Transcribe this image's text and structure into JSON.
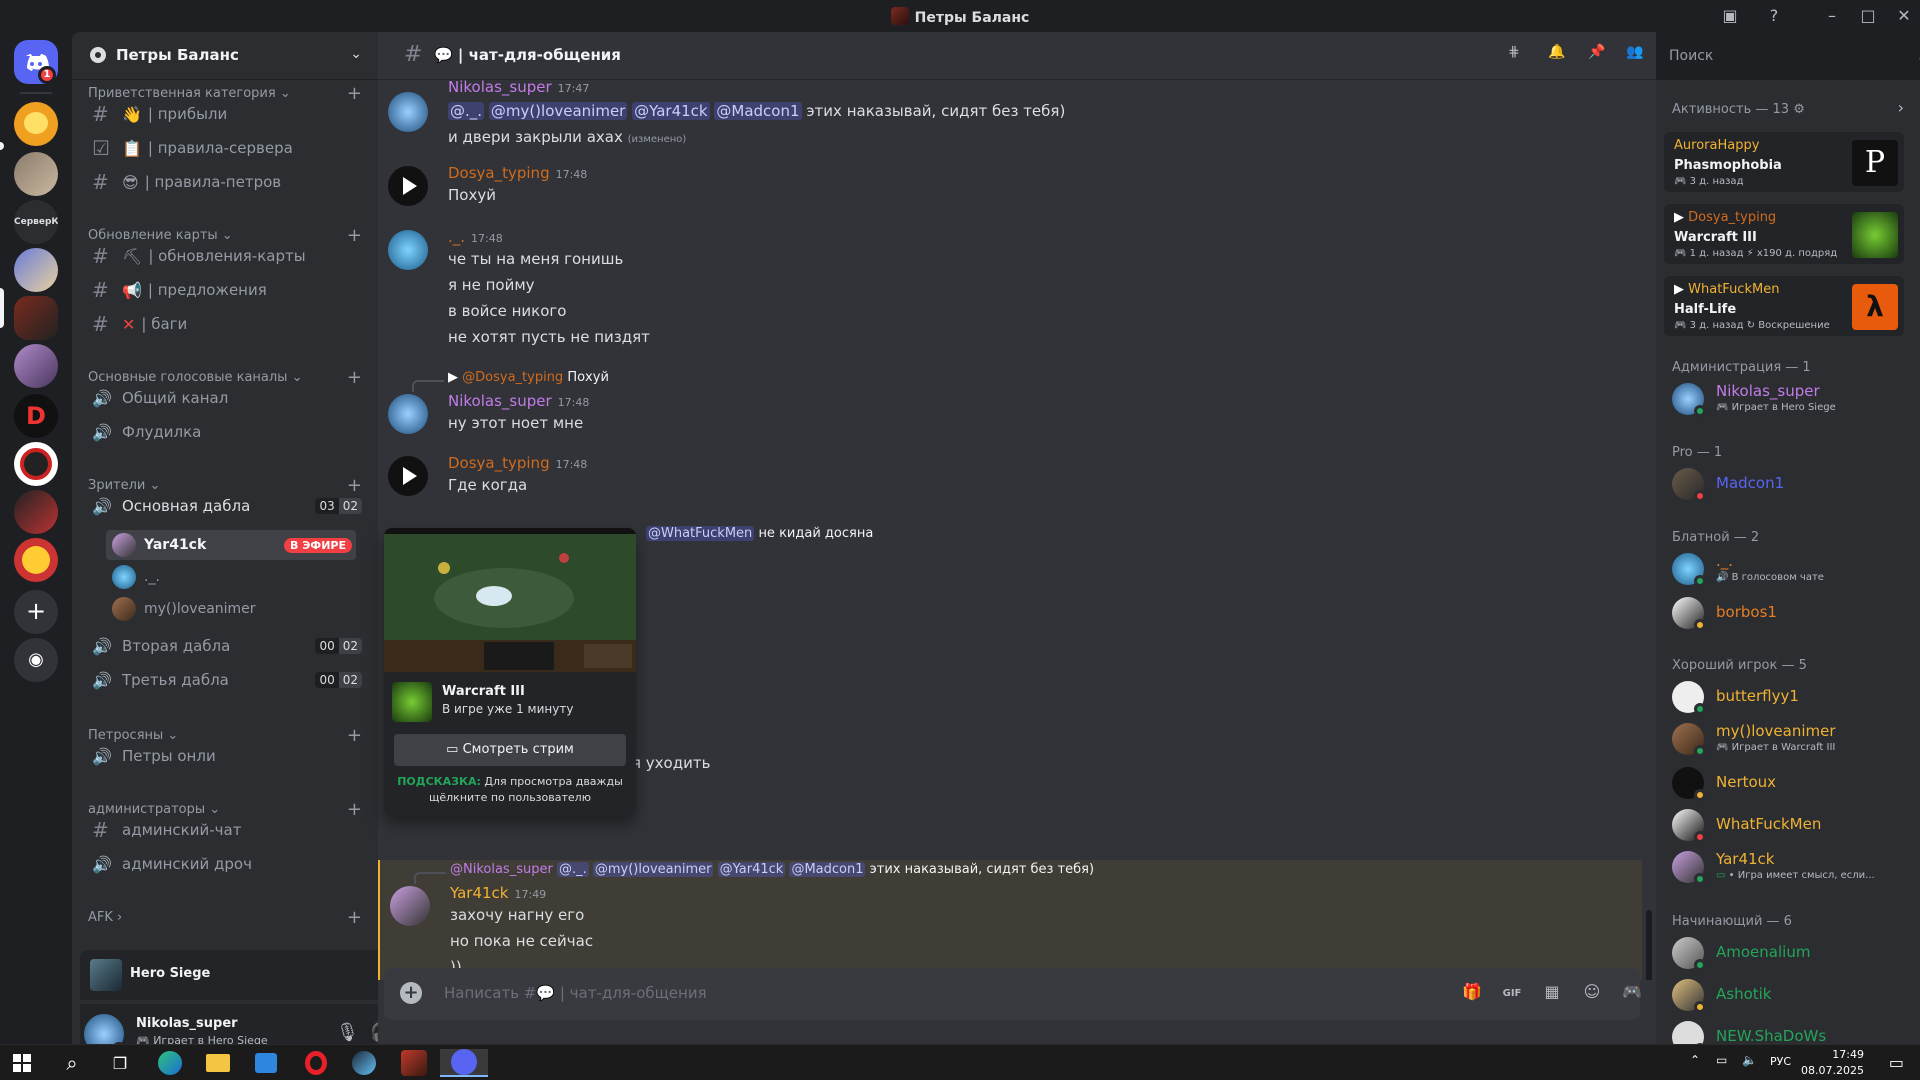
{
  "window": {
    "title": "Петры Баланс"
  },
  "server": {
    "name": "Петры Баланс",
    "dm_badge": "1",
    "folder_label": "СерверК"
  },
  "sidebar": {
    "categories": [
      "Приветственная категория ⌄",
      "Обновление карты ⌄",
      "Основные голосовые каналы ⌄",
      "Зрители ⌄",
      "Петросяны ⌄",
      "администраторы ⌄",
      "AFK ›"
    ],
    "channels": {
      "pribyli": "| прибыли",
      "pravila_servera": "| правила-сервера",
      "pravila_petrov": "| правила-петров",
      "obnovleniya": "| обновления-карты",
      "predlozheniya": "| предложения",
      "bagi": "| баги",
      "obshiy": "Общий канал",
      "fludilka": "Флудилка",
      "osnovnaya": "Основная дабла",
      "osnovnaya_cnt": [
        "03",
        "02"
      ],
      "vtoraya": "Вторая дабла",
      "vtoraya_cnt": [
        "00",
        "02"
      ],
      "tretya": "Третья дабла",
      "tretya_cnt": [
        "00",
        "02"
      ],
      "petry_onli": "Петры онли",
      "admin_chat": "админский-чат",
      "admin_droch": "админский дроч"
    },
    "voice_users": [
      "Yar41ck",
      "._.",
      "my()loveanimer"
    ],
    "live_badge": "В ЭФИРЕ"
  },
  "activity_bar": {
    "game": "Hero Siege"
  },
  "user_panel": {
    "name": "Nikolas_super",
    "status": "Играет в Hero Siege"
  },
  "channel": {
    "name": "| чат-для-общения"
  },
  "search": {
    "placeholder": "Поиск"
  },
  "messages": [
    {
      "id": "m1",
      "author": "Nikolas_super",
      "time": "17:47",
      "color": "#c27ce8",
      "mentions": [
        "@._.",
        "@my()loveanimer",
        "@Yar41ck",
        "@Madcon1"
      ],
      "text_after": "этих наказывай, сидят без тебя)",
      "line2": "и двери закрыли ахах",
      "edited": "(изменено)"
    },
    {
      "id": "m2",
      "author": "Dosya_typing",
      "time": "17:48",
      "color": "#d06b1d",
      "line": "Похуй"
    },
    {
      "id": "m3",
      "author": "._.",
      "time": "17:48",
      "color": "#d06b1d",
      "lines": [
        "че ты на меня гонишь",
        "я не пойму",
        "в войсе никого",
        "не хотят пусть не пиздят"
      ]
    },
    {
      "id": "m4",
      "author": "Nikolas_super",
      "time": "17:48",
      "color": "#c27ce8",
      "reply_to": "@Dosya_typing",
      "reply_text": "Похуй",
      "line": "ну этот ноет мне"
    },
    {
      "id": "m5",
      "author": "Dosya_typing",
      "time": "17:48",
      "color": "#d06b1d",
      "line": "Где когда"
    },
    {
      "id": "m6",
      "reply_mention": "@WhatFuckMen",
      "reply_text": "не кидай досяна",
      "partial_line": "я уходить"
    },
    {
      "id": "m7",
      "author": "Yar41ck",
      "time": "17:49",
      "color": "#f0b232",
      "reply_to": "@Nikolas_super",
      "reply_mentions": [
        "@._.",
        "@my()loveanimer",
        "@Yar41ck",
        "@Madcon1"
      ],
      "reply_text": "этих наказывай, сидят без тебя)",
      "lines": [
        "захочу нагну его",
        "но пока не сейчас",
        "))"
      ]
    }
  ],
  "composer": {
    "placeholder": "Написать #💬 | чат-для-общения"
  },
  "popout": {
    "game": "Warcraft III",
    "duration": "В игре уже 1 минуту",
    "watch_button": "Смотреть стрим",
    "tip_label": "ПОДСКАЗКА:",
    "tip_text": "Для просмотра дважды щёлкните по пользователю"
  },
  "members": {
    "activity_header": "Активность — 13 ⚙",
    "activity_cards": [
      {
        "user": "AuroraHappy",
        "user_color": "#f0b232",
        "game": "Phasmophobia",
        "time": "3 д. назад",
        "extra": ""
      },
      {
        "user": "Dosya_typing",
        "user_color": "#d06b1d",
        "game": "Warcraft III",
        "time": "1 д. назад",
        "extra": "x190 д. подряд"
      },
      {
        "user": "WhatFuckMen",
        "user_color": "#f0b232",
        "game": "Half-Life",
        "time": "3 д. назад",
        "extra": "Воскрешение"
      }
    ],
    "groups": [
      {
        "title": "Администрация — 1"
      },
      {
        "title": "Pro — 1"
      },
      {
        "title": "Блатной — 2"
      },
      {
        "title": "Хороший игрок — 5"
      },
      {
        "title": "Начинающий — 6"
      }
    ],
    "list": [
      {
        "name": "Nikolas_super",
        "color": "#c27ce8",
        "status": "Играет в Hero Siege",
        "dot": "#23a55a"
      },
      {
        "name": "Madcon1",
        "color": "#5865f2",
        "status": "",
        "dot": "#f23f43"
      },
      {
        "name": "._.",
        "color": "#e67e22",
        "status": "В голосовом чате",
        "dot": "#23a55a"
      },
      {
        "name": "borbos1",
        "color": "#e67e22",
        "status": "",
        "dot": "#f0b232"
      },
      {
        "name": "butterflyy1",
        "color": "#f0b232",
        "status": "",
        "dot": "#23a55a"
      },
      {
        "name": "my()loveanimer",
        "color": "#f0b232",
        "status": "Играет в Warcraft III",
        "dot": "#23a55a"
      },
      {
        "name": "Nertoux",
        "color": "#f0b232",
        "status": "",
        "dot": "#f0b232"
      },
      {
        "name": "WhatFuckMen",
        "color": "#f0b232",
        "status": "",
        "dot": "#f23f43"
      },
      {
        "name": "Yar41ck",
        "color": "#f0b232",
        "status": "• Игра имеет смысл, если...",
        "dot": "#23a55a"
      },
      {
        "name": "Amoenalium",
        "color": "#23a55a",
        "status": "",
        "dot": "#23a55a"
      },
      {
        "name": "Ashotik",
        "color": "#23a55a",
        "status": "",
        "dot": "#f0b232"
      },
      {
        "name": "NEW.ShaDoWs",
        "color": "#23a55a",
        "status": "",
        "dot": "#23a55a"
      }
    ]
  },
  "taskbar": {
    "lang": "РУС",
    "time": "17:49",
    "date": "08.07.2025"
  },
  "colors": {
    "bg_main": "#313338",
    "bg_side": "#2b2d31",
    "accent": "#5865f2",
    "live": "#f23f43"
  }
}
